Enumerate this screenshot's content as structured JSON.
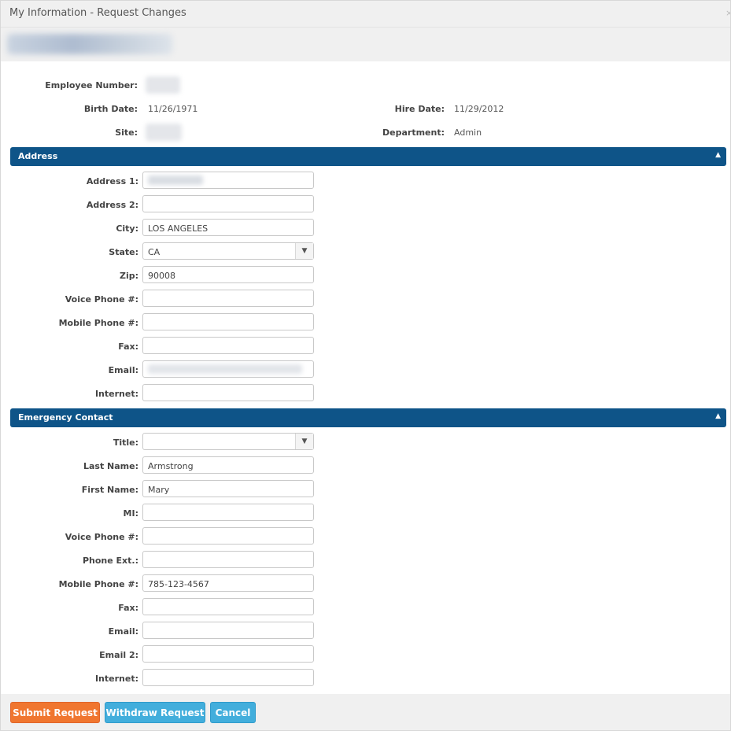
{
  "dialog": {
    "title": "My Information - Request Changes",
    "close": "×"
  },
  "info": {
    "employee_number_label": "Employee Number:",
    "birth_date_label": "Birth Date:",
    "birth_date": "11/26/1971",
    "hire_date_label": "Hire Date:",
    "hire_date": "11/29/2012",
    "site_label": "Site:",
    "department_label": "Department:",
    "department": "Admin"
  },
  "address": {
    "title": "Address",
    "collapse_icon": "▲",
    "fields": [
      {
        "label": "Address 1:",
        "value": ""
      },
      {
        "label": "Address 2:",
        "value": ""
      },
      {
        "label": "City:",
        "value": "LOS ANGELES"
      },
      {
        "label": "State:",
        "value": "CA"
      },
      {
        "label": "Zip:",
        "value": "90008"
      },
      {
        "label": "Voice Phone #:",
        "value": ""
      },
      {
        "label": "Mobile Phone #:",
        "value": ""
      },
      {
        "label": "Fax:",
        "value": ""
      },
      {
        "label": "Email:",
        "value": ""
      },
      {
        "label": "Internet:",
        "value": ""
      }
    ]
  },
  "emergency": {
    "title": "Emergency Contact",
    "collapse_icon": "▲",
    "fields": [
      {
        "label": "Title:",
        "value": ""
      },
      {
        "label": "Last Name:",
        "value": "Armstrong"
      },
      {
        "label": "First Name:",
        "value": "Mary"
      },
      {
        "label": "MI:",
        "value": ""
      },
      {
        "label": "Voice Phone #:",
        "value": ""
      },
      {
        "label": "Phone Ext.:",
        "value": ""
      },
      {
        "label": "Mobile Phone #:",
        "value": "785-123-4567"
      },
      {
        "label": "Fax:",
        "value": ""
      },
      {
        "label": "Email:",
        "value": ""
      },
      {
        "label": "Email 2:",
        "value": ""
      },
      {
        "label": "Internet:",
        "value": ""
      }
    ]
  },
  "dropdown_icon": "▼",
  "buttons": {
    "submit": "Submit Request",
    "withdraw": "Withdraw Request",
    "cancel": "Cancel"
  },
  "colors": {
    "section_header": "#0e5488",
    "submit": "#f0762f",
    "secondary": "#42aedc"
  }
}
